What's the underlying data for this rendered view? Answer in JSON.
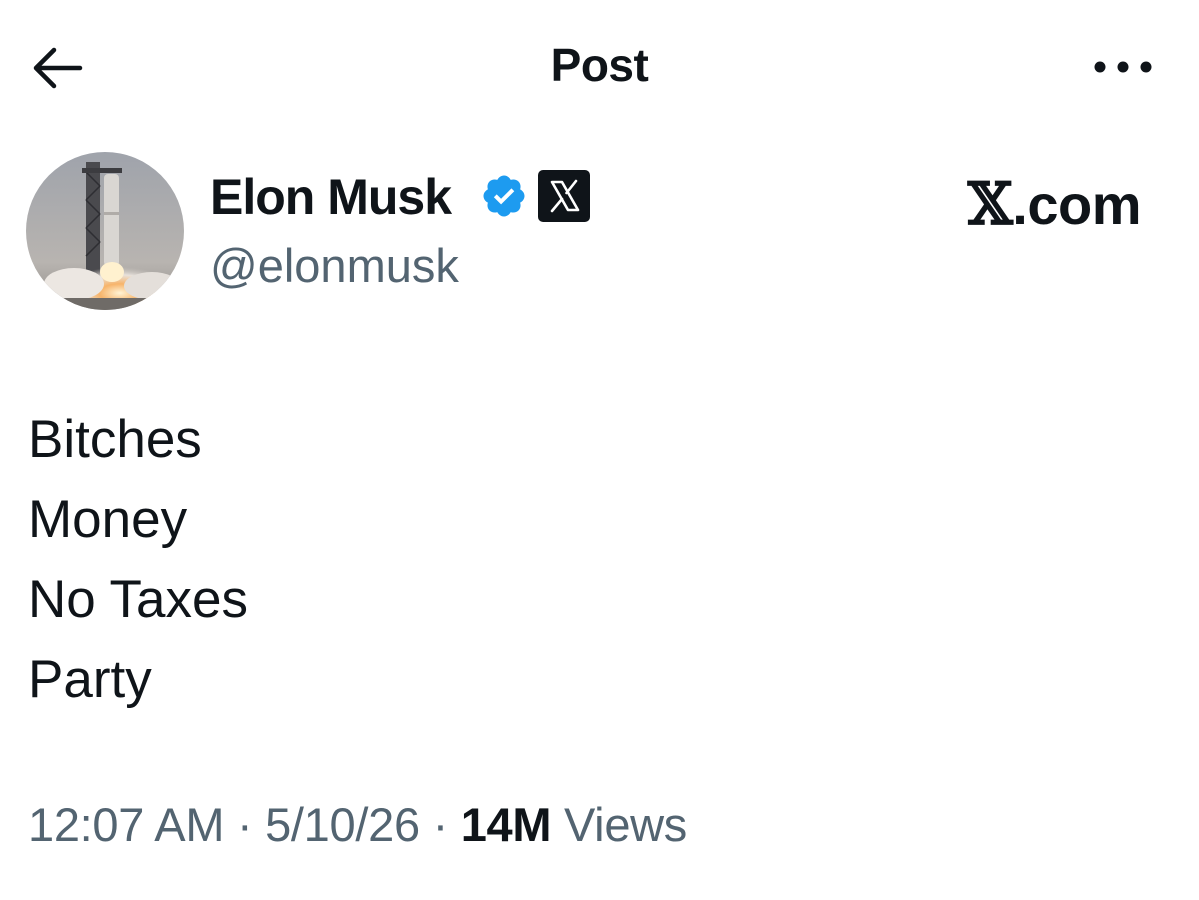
{
  "header": {
    "title": "Post",
    "back_icon": "arrow-left-icon",
    "more_icon": "more-horizontal-icon"
  },
  "author": {
    "name": "Elon Musk",
    "handle": "@elonmusk",
    "verified_icon": "verified-badge-icon",
    "verified_color": "#1d9bf0",
    "affiliate_icon": "x-logo-icon",
    "avatar": "rocket-launch-avatar"
  },
  "watermark": {
    "x_letter": "𝕏",
    "suffix": ".com"
  },
  "post": {
    "lines": [
      "Bitches",
      "Money",
      "No Taxes",
      "Party"
    ]
  },
  "meta": {
    "time": "12:07 AM",
    "date": "5/10/26",
    "separator": "·",
    "views_count": "14M",
    "views_label": "Views"
  },
  "colors": {
    "text_primary": "#0f1419",
    "text_secondary": "#536471",
    "background": "#ffffff"
  }
}
